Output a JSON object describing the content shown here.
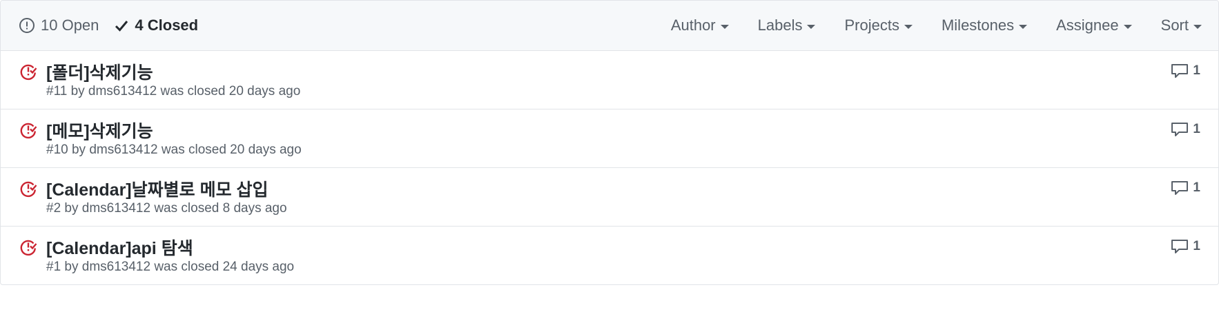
{
  "states": {
    "open_label": "10 Open",
    "closed_label": "4 Closed"
  },
  "filters": [
    {
      "label": "Author"
    },
    {
      "label": "Labels"
    },
    {
      "label": "Projects"
    },
    {
      "label": "Milestones"
    },
    {
      "label": "Assignee"
    },
    {
      "label": "Sort"
    }
  ],
  "issues": [
    {
      "title": "[폴더]삭제기능",
      "meta": "#11 by dms613412 was closed 20 days ago",
      "comments": "1"
    },
    {
      "title": "[메모]삭제기능",
      "meta": "#10 by dms613412 was closed 20 days ago",
      "comments": "1"
    },
    {
      "title": "[Calendar]날짜별로 메모 삽입",
      "meta": "#2 by dms613412 was closed 8 days ago",
      "comments": "1"
    },
    {
      "title": "[Calendar]api 탐색",
      "meta": "#1 by dms613412 was closed 24 days ago",
      "comments": "1"
    }
  ],
  "colors": {
    "closed_icon": "#cb2431",
    "muted_text": "#586069",
    "header_bg": "#f6f8fa"
  }
}
